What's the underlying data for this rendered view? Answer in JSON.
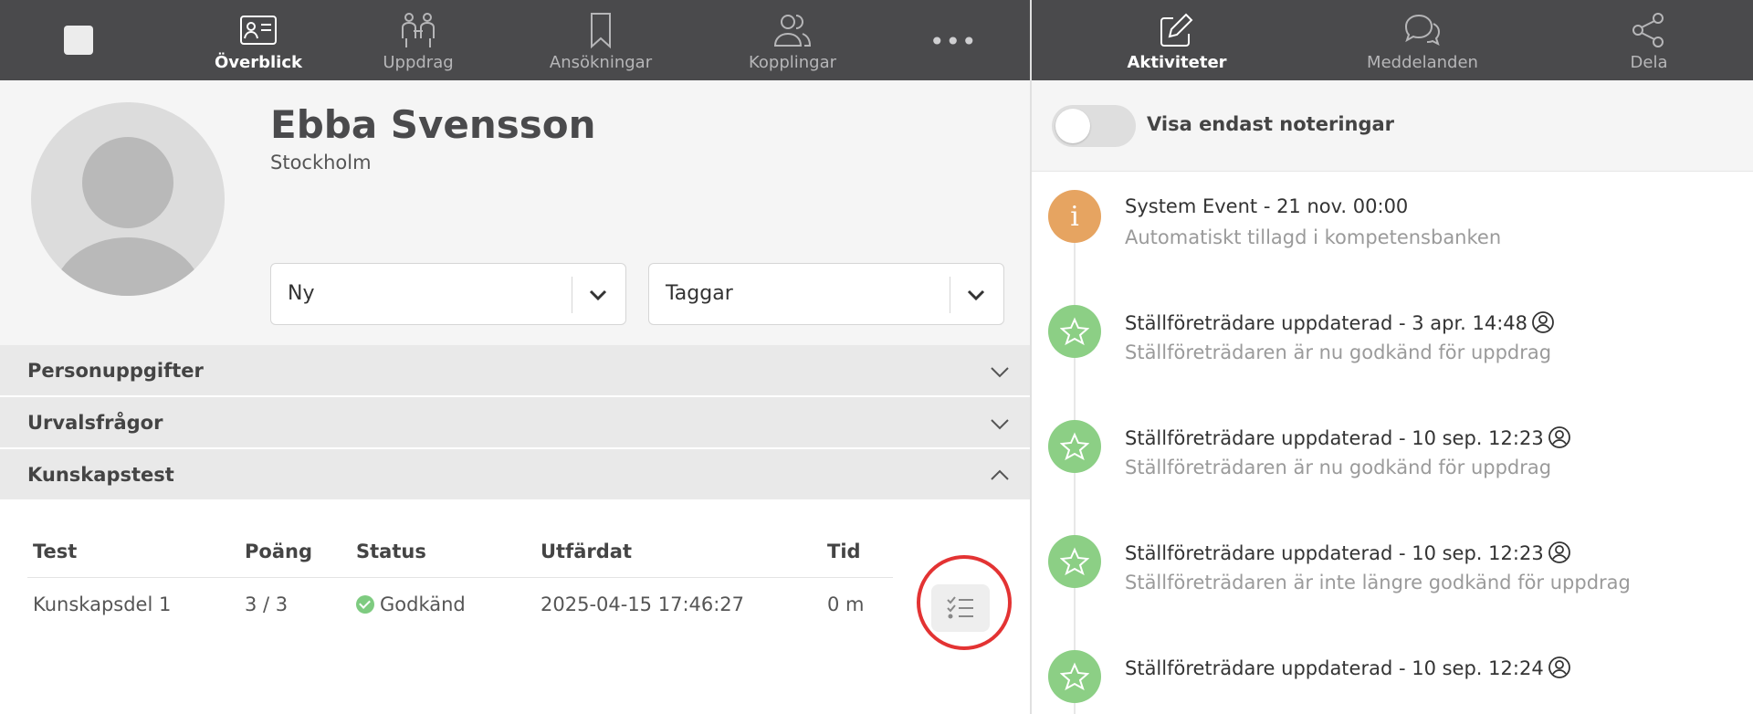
{
  "left_nav": {
    "items": [
      {
        "label": "Överblick",
        "icon": "id-card-icon",
        "active": true
      },
      {
        "label": "Uppdrag",
        "icon": "people-connect-icon",
        "active": false
      },
      {
        "label": "Ansökningar",
        "icon": "bookmark-icon",
        "active": false
      },
      {
        "label": "Kopplingar",
        "icon": "users-icon",
        "active": false
      }
    ],
    "more": "•••"
  },
  "profile": {
    "name": "Ebba Svensson",
    "city": "Stockholm",
    "status_select": "Ny",
    "tags_select": "Taggar"
  },
  "sections": [
    {
      "label": "Personuppgifter",
      "expanded": false
    },
    {
      "label": "Urvalsfrågor",
      "expanded": false
    },
    {
      "label": "Kunskapstest",
      "expanded": true
    }
  ],
  "test_table": {
    "headers": [
      "Test",
      "Poäng",
      "Status",
      "Utfärdat",
      "Tid"
    ],
    "rows": [
      {
        "test": "Kunskapsdel 1",
        "score": "3 / 3",
        "status": "Godkänd",
        "issued": "2025-04-15 17:46:27",
        "time": "0 m"
      }
    ]
  },
  "right_nav": {
    "items": [
      {
        "label": "Aktiviteter",
        "icon": "edit-icon",
        "active": true
      },
      {
        "label": "Meddelanden",
        "icon": "chat-icon",
        "active": false
      },
      {
        "label": "Dela",
        "icon": "share-icon",
        "active": false
      }
    ]
  },
  "activity_filter": {
    "label": "Visa endast noteringar",
    "enabled": false
  },
  "events": [
    {
      "type": "info",
      "title": "System Event - 21 nov. 00:00",
      "subtitle": "Automatiskt tillagd i kompetensbanken",
      "user_icon": false
    },
    {
      "type": "star",
      "title": "Ställföreträdare uppdaterad - 3 apr. 14:48",
      "subtitle": "Ställföreträdaren är nu godkänd för uppdrag",
      "user_icon": true
    },
    {
      "type": "star",
      "title": "Ställföreträdare uppdaterad - 10 sep. 12:23",
      "subtitle": "Ställföreträdaren är nu godkänd för uppdrag",
      "user_icon": true
    },
    {
      "type": "star",
      "title": "Ställföreträdare uppdaterad - 10 sep. 12:23",
      "subtitle": "Ställföreträdaren är inte längre godkänd för uppdrag",
      "user_icon": true
    },
    {
      "type": "star",
      "title": "Ställföreträdare uppdaterad - 10 sep. 12:24",
      "subtitle": "",
      "user_icon": true
    }
  ],
  "colors": {
    "nav_bg": "#4a4a4c",
    "info": "#e6a461",
    "success": "#8ccf85",
    "status_ok": "#7ecb80",
    "highlight": "#e33333"
  }
}
